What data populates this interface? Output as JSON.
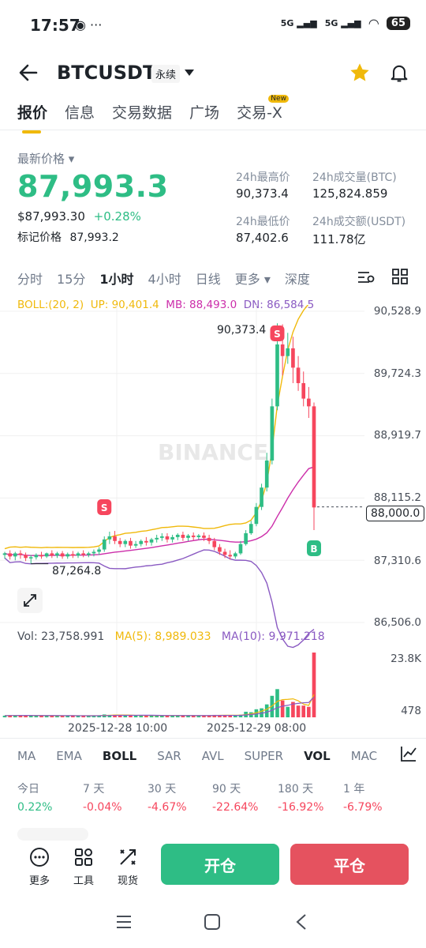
{
  "status_bar": {
    "time": "17:57",
    "network1": "5G",
    "network2": "5G",
    "battery": "65"
  },
  "header": {
    "symbol": "BTCUSDT",
    "contract_type": "永续"
  },
  "tabs": [
    {
      "label": "报价"
    },
    {
      "label": "信息"
    },
    {
      "label": "交易数据"
    },
    {
      "label": "广场"
    },
    {
      "label": "交易-X"
    }
  ],
  "new_badge": "New",
  "price": {
    "label": "最新价格",
    "last": "87,993.3",
    "usd": "$87,993.30",
    "change": "+0.28%",
    "mark_label": "标记价格",
    "mark": "87,993.2"
  },
  "stats": {
    "high_label": "24h最高价",
    "high": "90,373.4",
    "vol_btc_label": "24h成交量(BTC)",
    "vol_btc": "125,824.859",
    "low_label": "24h最低价",
    "low": "87,402.6",
    "vol_usdt_label": "24h成交额(USDT)",
    "vol_usdt": "111.78亿"
  },
  "intervals": [
    "分时",
    "15分",
    "1小时",
    "4小时",
    "日线",
    "更多",
    "深度"
  ],
  "active_interval": "1小时",
  "boll": {
    "label": "BOLL:(20, 2)",
    "up": "UP: 90,401.4",
    "mb": "MB: 88,493.0",
    "dn": "DN: 86,584.5"
  },
  "watermark": "BINANCE",
  "chart_data": {
    "type": "candlestick",
    "price_axis": [
      "90,528.9",
      "89,724.3",
      "88,919.7",
      "88,115.2",
      "87,310.6",
      "86,506.0"
    ],
    "ylim": [
      86506.0,
      90528.9
    ],
    "high_marker": "90,373.4",
    "low_marker": "87,264.8",
    "current_price": "88,000.0",
    "markers": [
      {
        "label": "S"
      },
      {
        "label": "S"
      },
      {
        "label": "B"
      }
    ],
    "candles": [
      {
        "o": 87380,
        "h": 87420,
        "c": 87400,
        "l": 87330
      },
      {
        "o": 87400,
        "h": 87440,
        "c": 87360,
        "l": 87320
      },
      {
        "o": 87360,
        "h": 87420,
        "c": 87400,
        "l": 87310
      },
      {
        "o": 87400,
        "h": 87440,
        "c": 87380,
        "l": 87330
      },
      {
        "o": 87380,
        "h": 87410,
        "c": 87340,
        "l": 87300
      },
      {
        "o": 87340,
        "h": 87380,
        "c": 87350,
        "l": 87264.8
      },
      {
        "o": 87350,
        "h": 87400,
        "c": 87380,
        "l": 87320
      },
      {
        "o": 87380,
        "h": 87420,
        "c": 87360,
        "l": 87330
      },
      {
        "o": 87360,
        "h": 87410,
        "c": 87400,
        "l": 87340
      },
      {
        "o": 87400,
        "h": 87440,
        "c": 87370,
        "l": 87340
      },
      {
        "o": 87370,
        "h": 87420,
        "c": 87400,
        "l": 87340
      },
      {
        "o": 87400,
        "h": 87430,
        "c": 87360,
        "l": 87330
      },
      {
        "o": 87360,
        "h": 87410,
        "c": 87390,
        "l": 87330
      },
      {
        "o": 87390,
        "h": 87430,
        "c": 87370,
        "l": 87340
      },
      {
        "o": 87370,
        "h": 87420,
        "c": 87400,
        "l": 87340
      },
      {
        "o": 87400,
        "h": 87440,
        "c": 87380,
        "l": 87350
      },
      {
        "o": 87380,
        "h": 87420,
        "c": 87400,
        "l": 87350
      },
      {
        "o": 87400,
        "h": 87450,
        "c": 87420,
        "l": 87360
      },
      {
        "o": 87420,
        "h": 87480,
        "c": 87450,
        "l": 87380
      },
      {
        "o": 87450,
        "h": 87620,
        "c": 87580,
        "l": 87420
      },
      {
        "o": 87580,
        "h": 87680,
        "c": 87620,
        "l": 87520
      },
      {
        "o": 87620,
        "h": 87690,
        "c": 87560,
        "l": 87520
      },
      {
        "o": 87560,
        "h": 87600,
        "c": 87520,
        "l": 87480
      },
      {
        "o": 87520,
        "h": 87580,
        "c": 87560,
        "l": 87480
      },
      {
        "o": 87560,
        "h": 87600,
        "c": 87500,
        "l": 87460
      },
      {
        "o": 87500,
        "h": 87560,
        "c": 87520,
        "l": 87470
      },
      {
        "o": 87520,
        "h": 87580,
        "c": 87560,
        "l": 87490
      },
      {
        "o": 87560,
        "h": 87610,
        "c": 87540,
        "l": 87500
      },
      {
        "o": 87540,
        "h": 87600,
        "c": 87580,
        "l": 87500
      },
      {
        "o": 87580,
        "h": 87640,
        "c": 87600,
        "l": 87540
      },
      {
        "o": 87600,
        "h": 87660,
        "c": 87620,
        "l": 87560
      },
      {
        "o": 87620,
        "h": 87660,
        "c": 87580,
        "l": 87540
      },
      {
        "o": 87580,
        "h": 87640,
        "c": 87610,
        "l": 87540
      },
      {
        "o": 87610,
        "h": 87660,
        "c": 87640,
        "l": 87570
      },
      {
        "o": 87640,
        "h": 87680,
        "c": 87600,
        "l": 87560
      },
      {
        "o": 87600,
        "h": 87650,
        "c": 87630,
        "l": 87560
      },
      {
        "o": 87630,
        "h": 87670,
        "c": 87610,
        "l": 87570
      },
      {
        "o": 87610,
        "h": 87650,
        "c": 87630,
        "l": 87580
      },
      {
        "o": 87630,
        "h": 87670,
        "c": 87600,
        "l": 87560
      },
      {
        "o": 87600,
        "h": 87640,
        "c": 87560,
        "l": 87520
      },
      {
        "o": 87560,
        "h": 87600,
        "c": 87480,
        "l": 87440
      },
      {
        "o": 87480,
        "h": 87520,
        "c": 87420,
        "l": 87380
      },
      {
        "o": 87420,
        "h": 87460,
        "c": 87380,
        "l": 87340
      },
      {
        "o": 87380,
        "h": 87440,
        "c": 87360,
        "l": 87320
      },
      {
        "o": 87360,
        "h": 87420,
        "c": 87400,
        "l": 87330
      },
      {
        "o": 87400,
        "h": 87560,
        "c": 87520,
        "l": 87380
      },
      {
        "o": 87520,
        "h": 87700,
        "c": 87660,
        "l": 87500
      },
      {
        "o": 87660,
        "h": 87820,
        "c": 87780,
        "l": 87640
      },
      {
        "o": 87780,
        "h": 88050,
        "c": 88000,
        "l": 87750
      },
      {
        "o": 88000,
        "h": 88300,
        "c": 88250,
        "l": 87960
      },
      {
        "o": 88250,
        "h": 88700,
        "c": 88600,
        "l": 88200
      },
      {
        "o": 88600,
        "h": 89400,
        "c": 89300,
        "l": 88550
      },
      {
        "o": 89300,
        "h": 90373.4,
        "c": 90100,
        "l": 89250
      },
      {
        "o": 90100,
        "h": 90360,
        "c": 89950,
        "l": 89700
      },
      {
        "o": 89950,
        "h": 90250,
        "c": 90050,
        "l": 89850
      },
      {
        "o": 90050,
        "h": 90200,
        "c": 89800,
        "l": 89600
      },
      {
        "o": 89800,
        "h": 89950,
        "c": 89600,
        "l": 89500
      },
      {
        "o": 89600,
        "h": 89750,
        "c": 89400,
        "l": 89300
      },
      {
        "o": 89400,
        "h": 89550,
        "c": 89300,
        "l": 89150
      },
      {
        "o": 89300,
        "h": 89350,
        "c": 87993.3,
        "l": 87700
      }
    ],
    "volume": {
      "label": "Vol: 23,758.991",
      "ma5": "MA(5): 8,989.033",
      "ma10": "MA(10): 9,971.218",
      "axis": [
        "23.8K",
        "478"
      ],
      "ylim": [
        0,
        23800
      ]
    },
    "x_ticks": [
      "2025-12-28 10:00",
      "2025-12-29 08:00"
    ]
  },
  "indicators": [
    "MA",
    "EMA",
    "BOLL",
    "SAR",
    "AVL",
    "SUPER",
    "VOL",
    "MAC"
  ],
  "active_indicators": [
    "BOLL",
    "VOL"
  ],
  "performance": [
    {
      "label": "今日",
      "value": "0.22%",
      "color": "#2ebd85"
    },
    {
      "label": "7 天",
      "value": "-0.04%",
      "color": "#f6465d"
    },
    {
      "label": "30 天",
      "value": "-4.67%",
      "color": "#f6465d"
    },
    {
      "label": "90 天",
      "value": "-22.64%",
      "color": "#f6465d"
    },
    {
      "label": "180 天",
      "value": "-16.92%",
      "color": "#f6465d"
    },
    {
      "label": "1 年",
      "value": "-6.79%",
      "color": "#f6465d"
    }
  ],
  "bottom": {
    "more": "更多",
    "tools": "工具",
    "spot": "现货",
    "open": "开仓",
    "close": "平仓"
  },
  "colors": {
    "up": "#2ebd85",
    "down": "#f6465d",
    "accent": "#f0b90b",
    "boll_up": "#f0b90b",
    "boll_mb": "#cc2eaa",
    "boll_dn": "#8a5ac2",
    "ma5": "#f0b90b",
    "ma10": "#8a5ac2"
  }
}
